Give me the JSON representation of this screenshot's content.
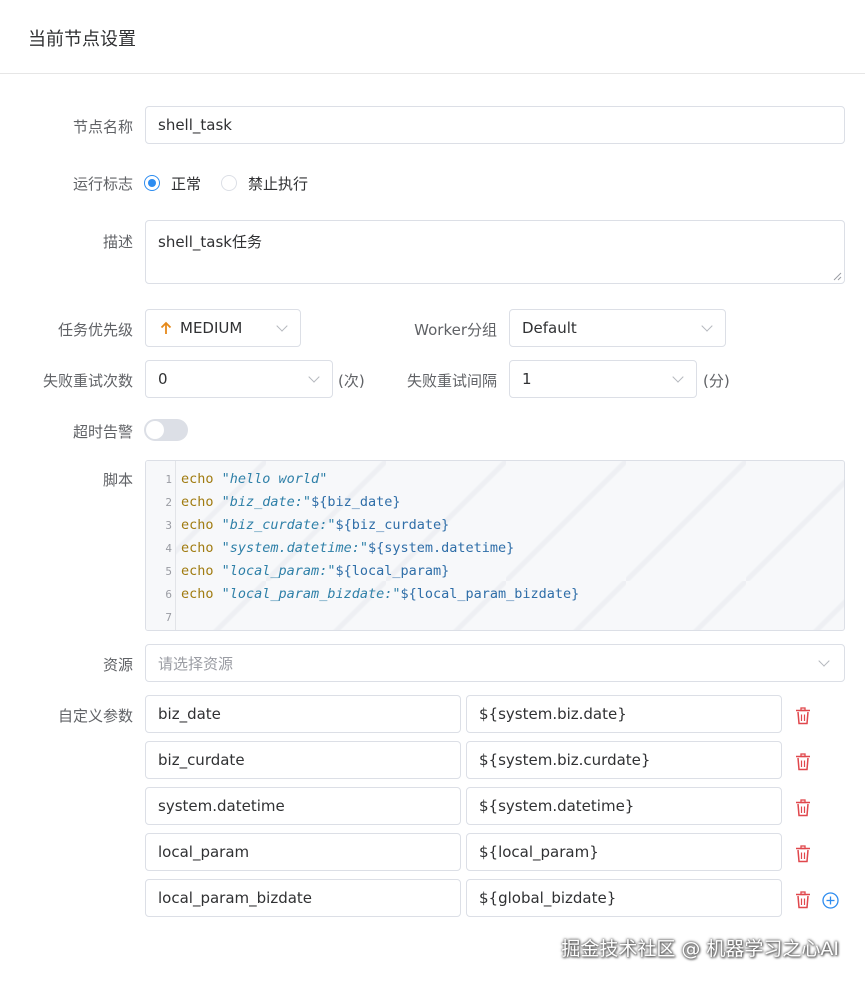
{
  "header": {
    "title": "当前节点设置"
  },
  "form": {
    "node_name": {
      "label": "节点名称",
      "value": "shell_task"
    },
    "run_flag": {
      "label": "运行标志",
      "options": [
        "正常",
        "禁止执行"
      ],
      "selected": "正常"
    },
    "description": {
      "label": "描述",
      "value": "shell_task任务"
    },
    "priority": {
      "label": "任务优先级",
      "value": "MEDIUM",
      "icon": "arrow-up-icon",
      "icon_color": "#e6891a"
    },
    "worker_group": {
      "label": "Worker分组",
      "value": "Default"
    },
    "retry_times": {
      "label": "失败重试次数",
      "value": "0",
      "unit": "(次)"
    },
    "retry_interval": {
      "label": "失败重试间隔",
      "value": "1",
      "unit": "(分)"
    },
    "timeout_alarm": {
      "label": "超时告警",
      "enabled": false
    },
    "script": {
      "label": "脚本",
      "lines": [
        {
          "no": "1",
          "kw": "echo",
          "str": "\"hello world\"",
          "var": ""
        },
        {
          "no": "2",
          "kw": "echo",
          "str": "\"biz_date:\"",
          "var": "${biz_date}"
        },
        {
          "no": "3",
          "kw": "echo",
          "str": "\"biz_curdate:\"",
          "var": "${biz_curdate}"
        },
        {
          "no": "4",
          "kw": "echo",
          "str": "\"system.datetime:\"",
          "var": "${system.datetime}"
        },
        {
          "no": "5",
          "kw": "echo",
          "str": "\"local_param:\"",
          "var": "${local_param}"
        },
        {
          "no": "6",
          "kw": "echo",
          "str": "\"local_param_bizdate:\"",
          "var": "${local_param_bizdate}"
        },
        {
          "no": "7",
          "kw": "",
          "str": "",
          "var": ""
        }
      ]
    },
    "resource": {
      "label": "资源",
      "placeholder": "请选择资源"
    },
    "custom_params": {
      "label": "自定义参数",
      "rows": [
        {
          "key": "biz_date",
          "value": "${system.biz.date}"
        },
        {
          "key": "biz_curdate",
          "value": "${system.biz.curdate}"
        },
        {
          "key": "system.datetime",
          "value": "${system.datetime}"
        },
        {
          "key": "local_param",
          "value": "${local_param}"
        },
        {
          "key": "local_param_bizdate",
          "value": "${global_bizdate}"
        }
      ]
    }
  },
  "colors": {
    "accent": "#2d8cf0",
    "danger": "#e0474c"
  },
  "watermark": "掘金技术社区 @ 机器学习之心AI"
}
